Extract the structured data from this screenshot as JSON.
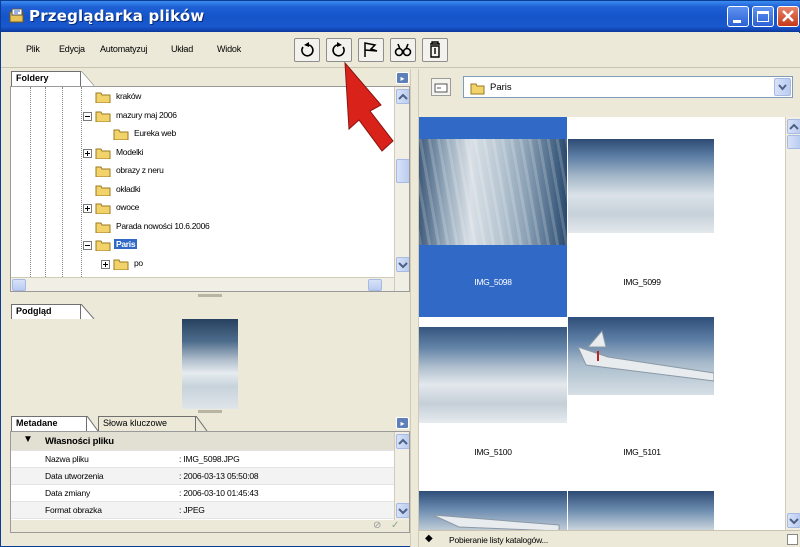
{
  "window": {
    "title": "Przeglądarka plików",
    "title_color": "#1453c8"
  },
  "menu": {
    "items": [
      "Plik",
      "Edycja",
      "Automatyzuj",
      "Układ",
      "Widok"
    ]
  },
  "toolbar": {
    "tools": [
      "rotate-left-icon",
      "rotate-right-icon",
      "flag-icon",
      "binoculars-icon",
      "trash-icon"
    ]
  },
  "folders": {
    "tab_label": "Foldery",
    "items": [
      {
        "label": "kraków",
        "expander": "none"
      },
      {
        "label": "mazury maj 2006",
        "expander": "minus"
      },
      {
        "label": "Eureka web",
        "expander": "none"
      },
      {
        "label": "Modelki",
        "expander": "plus"
      },
      {
        "label": "obrazy z neru",
        "expander": "none"
      },
      {
        "label": "okładki",
        "expander": "none"
      },
      {
        "label": "owoce",
        "expander": "plus"
      },
      {
        "label": "Parada nowości 10.6.2006",
        "expander": "none"
      },
      {
        "label": "Paris",
        "expander": "minus",
        "selected": true
      },
      {
        "label": "po",
        "expander": "plus"
      }
    ]
  },
  "preview": {
    "tab_label": "Podgląd"
  },
  "metadata": {
    "tabs": [
      "Metadane",
      "Słowa kluczowe"
    ],
    "section_title": "Własności pliku",
    "rows": [
      {
        "key": "Nazwa pliku",
        "value": ": IMG_5098.JPG"
      },
      {
        "key": "Data utworzenia",
        "value": ": 2006-03-13 05:50:08"
      },
      {
        "key": "Data zmiany",
        "value": ": 2006-03-10 01:45:43"
      },
      {
        "key": "Format obrazka",
        "value": ": JPEG"
      }
    ]
  },
  "browser": {
    "path": "Paris",
    "thumbnails": [
      {
        "name": "IMG_5098",
        "selected": true
      },
      {
        "name": "IMG_5099",
        "selected": false
      },
      {
        "name": "IMG_5100",
        "selected": false
      },
      {
        "name": "IMG_5101",
        "selected": false
      }
    ],
    "status": "Pobieranie listy katalogów..."
  },
  "colors": {
    "selection": "#3169c6",
    "arrow_annotation": "#d9231a"
  }
}
